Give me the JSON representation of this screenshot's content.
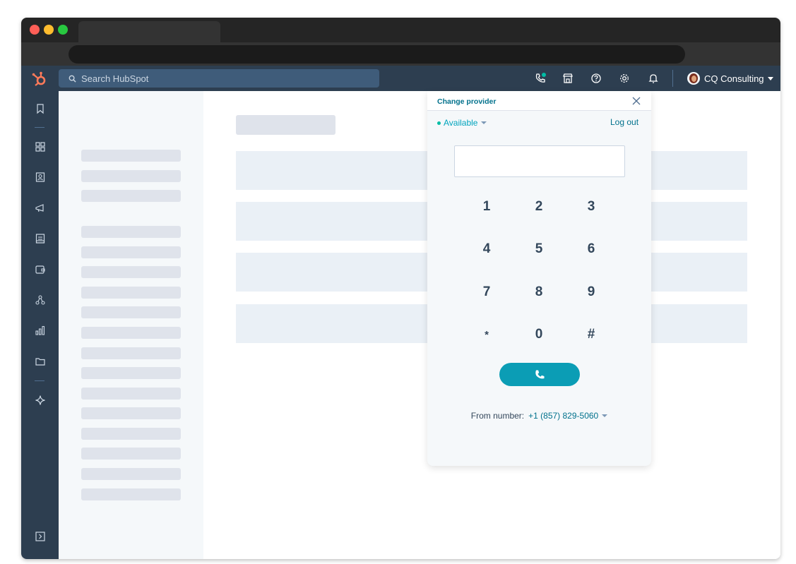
{
  "search": {
    "placeholder": "Search HubSpot"
  },
  "account": {
    "name": "CQ Consulting"
  },
  "dialer": {
    "change_provider": "Change provider",
    "status": "Available",
    "logout": "Log out",
    "keys": [
      "1",
      "2",
      "3",
      "4",
      "5",
      "6",
      "7",
      "8",
      "9",
      "*",
      "0",
      "#"
    ],
    "from_label": "From number:",
    "from_number": "+1 (857) 829-5060"
  },
  "colors": {
    "nav": "#2d3e50",
    "accent": "#00a4bd",
    "call_button": "#0b9db5",
    "logo": "#ff7a59"
  },
  "icons": {
    "topnav": [
      "phone-calling-icon",
      "marketplace-icon",
      "help-icon",
      "settings-icon",
      "notifications-icon"
    ],
    "sidenav": [
      "bookmarks-icon",
      "dashboard-icon",
      "contacts-icon",
      "marketing-icon",
      "content-icon",
      "commerce-icon",
      "automation-icon",
      "reporting-icon",
      "library-icon",
      "ai-sparkle-icon",
      "expand-nav-icon"
    ]
  }
}
